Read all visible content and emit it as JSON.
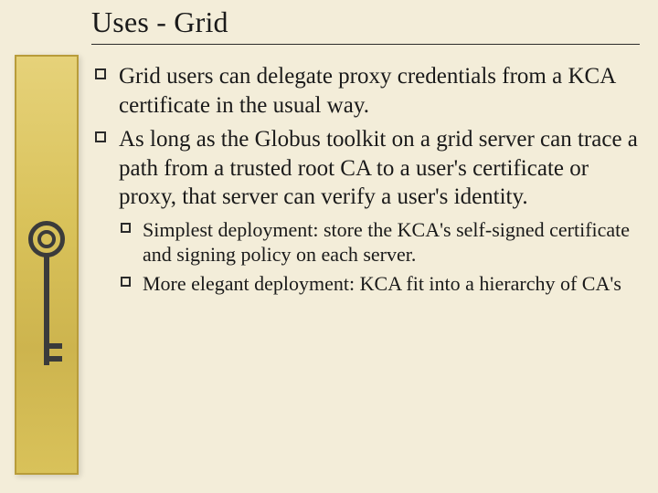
{
  "title": "Uses - Grid",
  "bullets": {
    "b1": "Grid users can delegate proxy credentials from a KCA certificate in the usual way.",
    "b2": "As long as the Globus toolkit on a grid server can trace a path from a trusted root CA to a user's certificate or proxy, that server can verify a user's identity.",
    "sub": {
      "s1": "Simplest deployment: store the KCA's self-signed certificate and signing policy on each server.",
      "s2": "More elegant deployment: KCA fit into a hierarchy of CA's"
    }
  }
}
